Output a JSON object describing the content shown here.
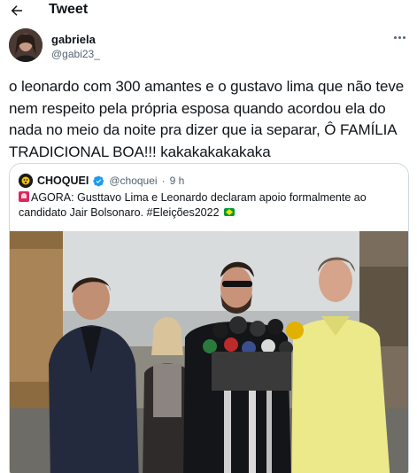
{
  "header": {
    "title": "Tweet",
    "back_icon": "arrow-left-icon"
  },
  "tweet": {
    "author": {
      "display_name": "gabriela",
      "handle": "@gabi23_"
    },
    "text": "o leonardo com 300 amantes e o gustavo lima que não teve nem respeito pela própria esposa quando acordou ela do nada no meio da noite pra dizer que ia separar, Ô FAMÍLIA TRADICIONAL BOA!!! kakakakakakaka",
    "more_icon": "more-horizontal-icon"
  },
  "quoted_tweet": {
    "author": {
      "display_name": "CHOQUEI",
      "handle": "@choquei",
      "separator": "·",
      "time": "9 h",
      "verified_icon": "verified-badge-icon"
    },
    "text": "AGORA: Gusttavo Lima e Leonardo declaram apoio formalmente ao candidato Jair Bolsonaro. #Eleições2022",
    "leading_emoji": "siren-icon",
    "trailing_emoji": "brazil-flag-icon",
    "media": "photo of four people at a press conference with microphones"
  },
  "colors": {
    "text": "#0f1419",
    "secondary": "#536471",
    "border": "#cfd9de",
    "verified": "#1d9bf0"
  }
}
